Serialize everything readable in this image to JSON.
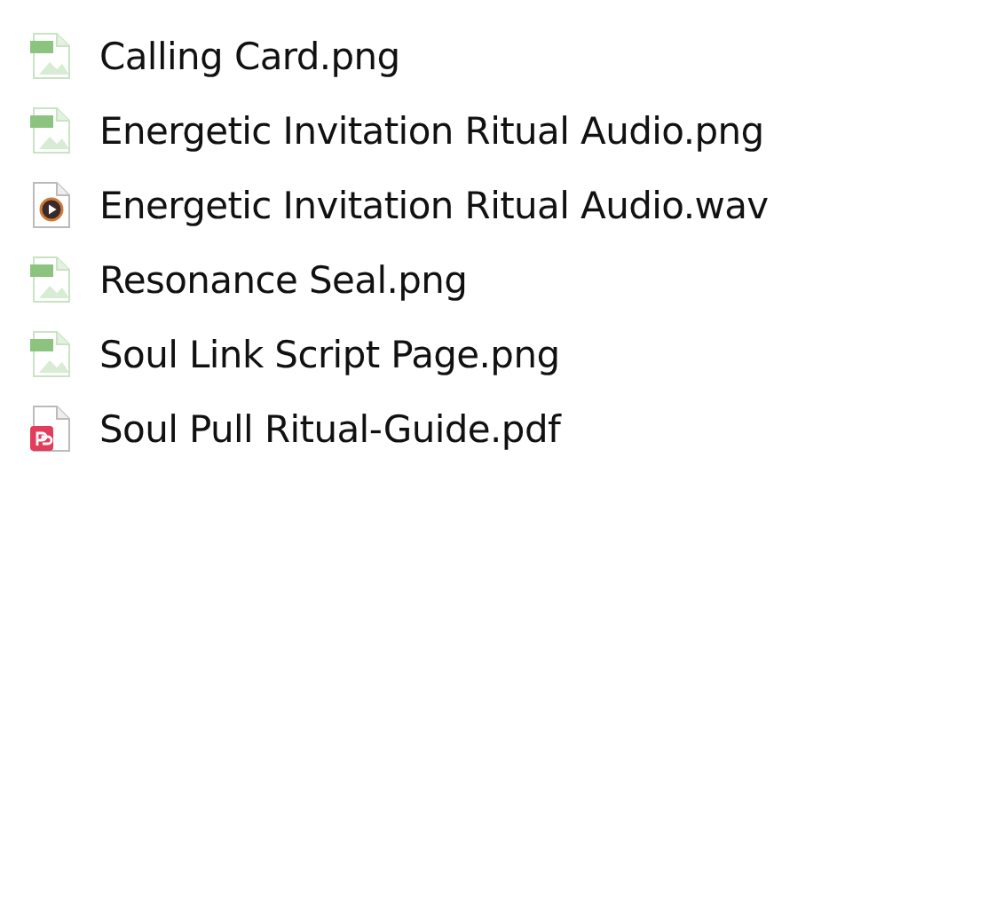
{
  "files": [
    {
      "name": "Calling Card.png",
      "kind": "png"
    },
    {
      "name": "Energetic Invitation Ritual Audio.png",
      "kind": "png"
    },
    {
      "name": "Energetic Invitation Ritual Audio.wav",
      "kind": "wav"
    },
    {
      "name": "Resonance Seal.png",
      "kind": "png"
    },
    {
      "name": "Soul Link Script Page.png",
      "kind": "png"
    },
    {
      "name": "Soul Pull Ritual-Guide.pdf",
      "kind": "pdf"
    }
  ]
}
